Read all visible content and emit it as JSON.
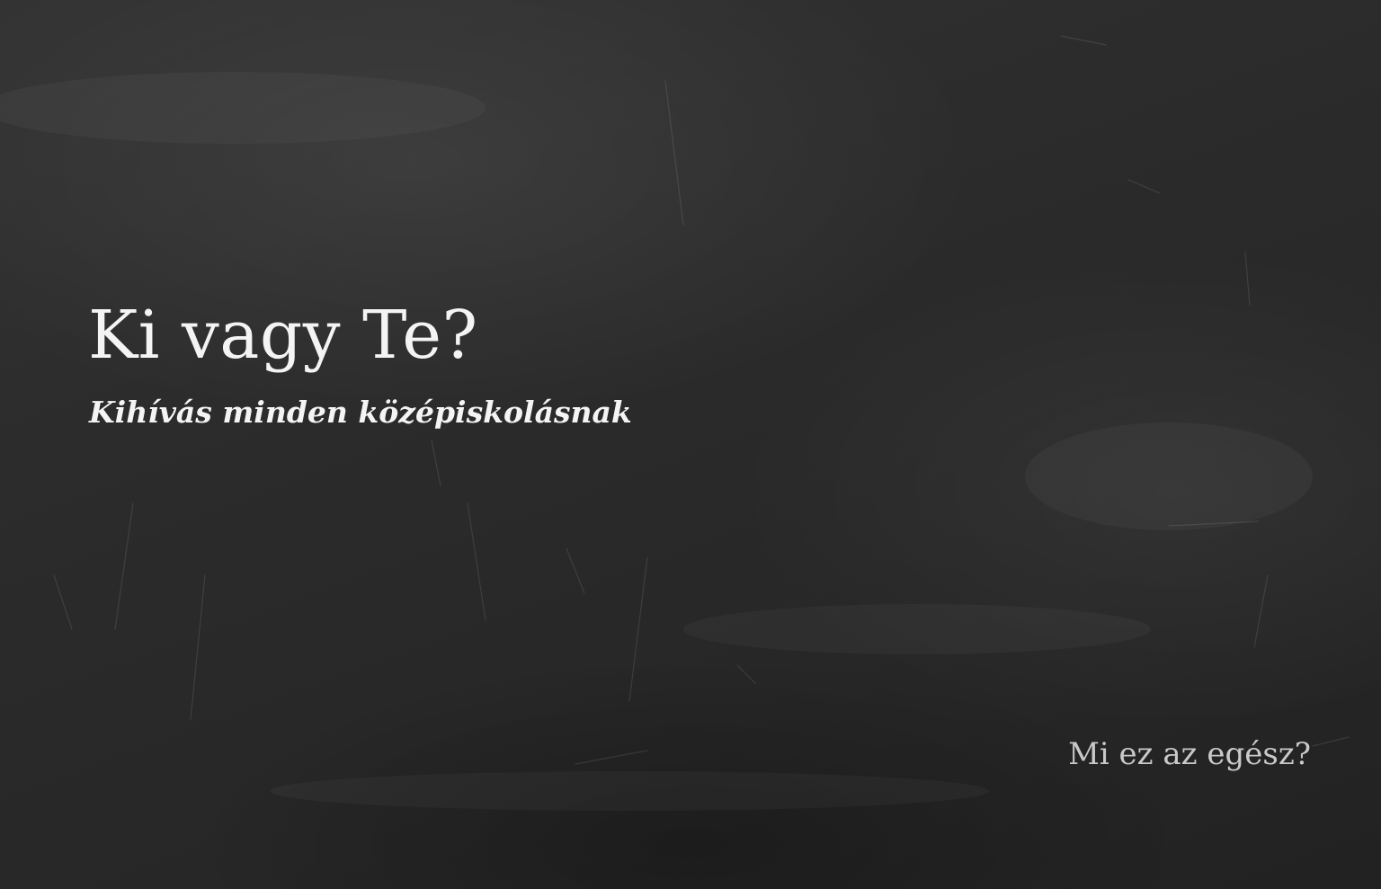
{
  "hero": {
    "title": "Ki vagy Te?",
    "subtitle": "Kihívás minden középiskolásnak"
  },
  "footer": {
    "about_link": "Mi ez az egész?"
  },
  "colors": {
    "background": "#2a2a2a",
    "text": "#f4f4f4",
    "link": "#c9c9c9"
  }
}
